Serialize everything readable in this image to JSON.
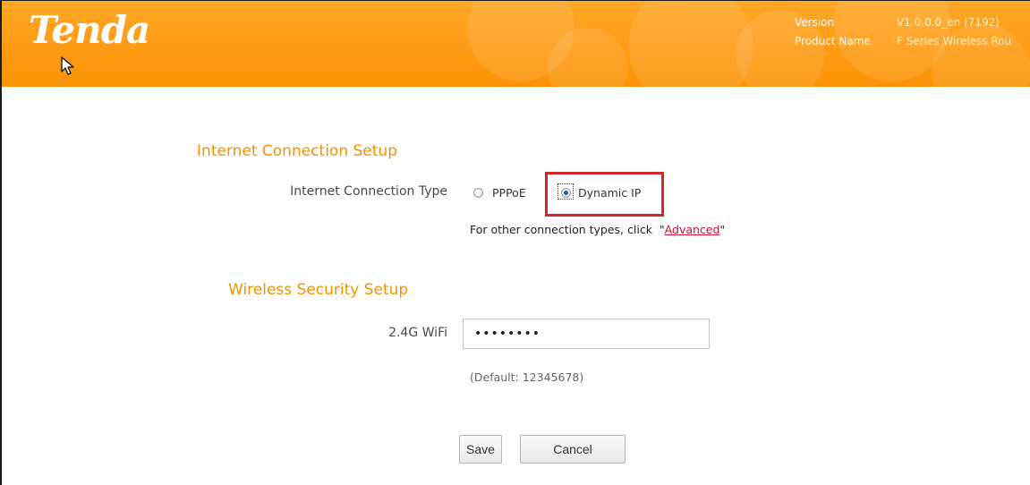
{
  "header": {
    "logo_text": "Tenda",
    "version_label": "Version",
    "version_value": "V1.0.0.0_en (7192)",
    "product_label": "Product Name",
    "product_value": "F Series Wireless Rou",
    "colors": {
      "background": "#ff9a12",
      "text": "#ffffff"
    }
  },
  "internet_setup": {
    "title": "Internet Connection Setup",
    "connection_type_label": "Internet Connection Type",
    "options": [
      {
        "label": "PPPoE",
        "selected": false
      },
      {
        "label": "Dynamic IP",
        "selected": true
      }
    ],
    "hint_prefix": "For other connection types, click",
    "hint_quote_open": "\"",
    "hint_link": "Advanced",
    "hint_quote_close": "\""
  },
  "wireless_setup": {
    "title": "Wireless Security Setup",
    "wifi_label": "2.4G WiFi",
    "wifi_password_value": "12345678",
    "default_note": "(Default: 12345678)"
  },
  "actions": {
    "save_label": "Save",
    "cancel_label": "Cancel"
  },
  "colors": {
    "accent": "#f39200",
    "highlight": "#d6242b",
    "link": "#c8102e"
  },
  "icons": [
    "mouse-pointer-icon",
    "radio-button-icon"
  ]
}
